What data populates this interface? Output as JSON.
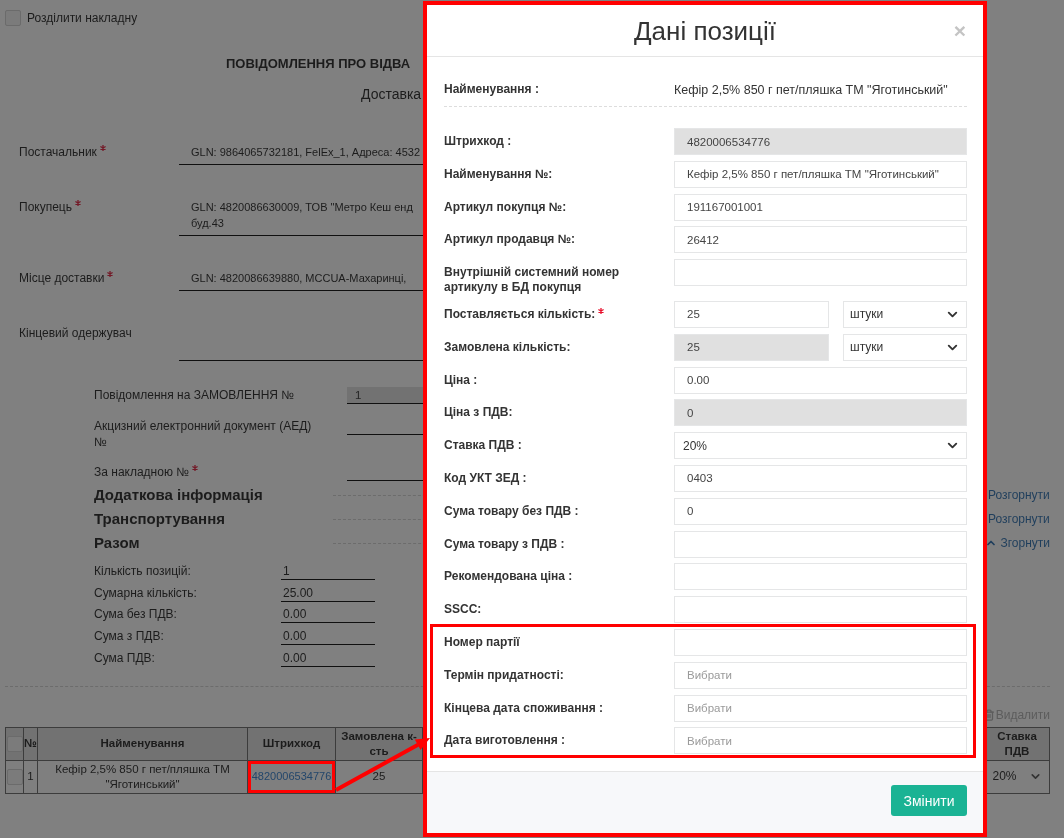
{
  "page": {
    "split_invoice": {
      "label": "Розділити накладну",
      "checked": false
    },
    "title": "ПОВІДОМЛЕННЯ ПРО ВІДВА",
    "subtitle": "Доставка",
    "parties": [
      {
        "label": "Постачальник",
        "required": true,
        "value_lines": [
          "GLN: 9864065732181, FelEx_1, Адреса: 4532"
        ]
      },
      {
        "label": "Покупець",
        "required": true,
        "value_lines": [
          "GLN: 4820086630009, ТОВ \"Метро Кеш енд",
          "буд.43"
        ]
      },
      {
        "label": "Місце доставки",
        "required": true,
        "value_lines": [
          "GLN: 4820086639880, MCCUA-Махаринці,"
        ]
      },
      {
        "label": "Кінцевий одержувач",
        "required": false
      }
    ],
    "references": [
      {
        "label": "Повідомлення на ЗАМОВЛЕННЯ №",
        "required": false,
        "readonly": true,
        "value": "1"
      },
      {
        "label": "Акцизний електронний документ (АЕД) №",
        "required": false,
        "readonly": false
      },
      {
        "label": "За накладною №",
        "required": true,
        "readonly": false
      }
    ],
    "sections": [
      {
        "title": "Додаткова інформація",
        "toggle": "Розгорнути",
        "expanded": false
      },
      {
        "title": "Транспортування",
        "toggle": "Розгорнути",
        "expanded": false
      },
      {
        "title": "Разом",
        "toggle": "Згорнути",
        "expanded": true,
        "rows": [
          {
            "label": "Кількість позицій:",
            "value": "1"
          },
          {
            "label": "Сумарна кількість:",
            "value": "25.00"
          },
          {
            "label": "Сума без ПДВ:",
            "value": "0.00"
          },
          {
            "label": "Сума з ПДВ:",
            "value": "0.00"
          },
          {
            "label": "Сума ПДВ:",
            "value": "0.00"
          }
        ]
      }
    ],
    "delete_button": {
      "label": "Видалити",
      "disabled": true
    },
    "table": {
      "select_all": {
        "checked": false
      },
      "columns": [
        "№",
        "Найменування",
        "Штрихкод",
        "Замовлена к-сть",
        "Ставка ПДВ"
      ],
      "rows": [
        {
          "checked": false,
          "number": "1",
          "name": "Кефір 2,5% 850 г пет/пляшка ТМ \"Яготинський\"",
          "barcode": "4820006534776",
          "barcode_highlighted": true,
          "ordered_qty": "25",
          "vat_rate": "20%"
        }
      ]
    }
  },
  "modal": {
    "title": "Дані позиції",
    "close": "×",
    "highlighted": true,
    "name_label": "Найменування :",
    "name_value": "Кефір 2,5% 850 г пет/пляшка ТМ \"Яготинський\"",
    "fields": [
      {
        "label": "Штрихкод :",
        "kind": "input",
        "value": "4820006534776",
        "readonly": true,
        "required": false,
        "highlighted": false
      },
      {
        "label": "Найменування №:",
        "kind": "input",
        "value": "Кефір 2,5% 850 г пет/пляшка ТМ \"Яготинський\"",
        "readonly": false,
        "required": false,
        "highlighted": false
      },
      {
        "label": "Артикул покупця №:",
        "kind": "input",
        "value": "191167001001",
        "readonly": false,
        "required": false,
        "highlighted": false
      },
      {
        "label": "Артикул продавця №:",
        "kind": "input",
        "value": "26412",
        "readonly": false,
        "required": false,
        "highlighted": false
      },
      {
        "label": "Внутрішній системний номер артикулу в БД покупця",
        "kind": "input",
        "readonly": false,
        "required": false,
        "highlighted": false
      },
      {
        "label": "Поставляється кількість:",
        "kind": "quantity",
        "value": "25",
        "unit": "штуки",
        "readonly": false,
        "required": true,
        "highlighted": false
      },
      {
        "label": "Замовлена кількість:",
        "kind": "quantity",
        "value": "25",
        "unit": "штуки",
        "readonly": true,
        "required": false,
        "highlighted": false
      },
      {
        "label": "Ціна :",
        "kind": "input",
        "value": "0.00",
        "readonly": false,
        "required": false,
        "highlighted": false
      },
      {
        "label": "Ціна з ПДВ:",
        "kind": "input",
        "value": "0",
        "readonly": true,
        "required": false,
        "highlighted": false
      },
      {
        "label": "Ставка ПДВ :",
        "kind": "select",
        "value": "20%",
        "readonly": false,
        "required": false,
        "highlighted": false
      },
      {
        "label": "Код УКТ ЗЕД :",
        "kind": "input",
        "value": "0403",
        "readonly": false,
        "required": false,
        "highlighted": false
      },
      {
        "label": "Сума товару без ПДВ :",
        "kind": "input",
        "value": "0",
        "readonly": false,
        "required": false,
        "highlighted": false
      },
      {
        "label": "Сума товару з ПДВ :",
        "kind": "input",
        "readonly": false,
        "required": false,
        "highlighted": false
      },
      {
        "label": "Рекомендована ціна :",
        "kind": "input",
        "readonly": false,
        "required": false,
        "highlighted": false
      },
      {
        "label": "SSCC:",
        "kind": "input",
        "readonly": false,
        "required": false,
        "highlighted": false
      },
      {
        "label": "Номер партії",
        "kind": "input",
        "readonly": false,
        "required": false,
        "highlighted": true
      },
      {
        "label": "Термін придатності:",
        "kind": "input",
        "placeholder": "Вибрати",
        "readonly": false,
        "required": false,
        "highlighted": true
      },
      {
        "label": "Кінцева дата споживання :",
        "kind": "input",
        "placeholder": "Вибрати",
        "readonly": false,
        "required": false,
        "highlighted": true
      },
      {
        "label": "Дата виготовлення :",
        "kind": "input",
        "placeholder": "Вибрати",
        "readonly": false,
        "required": false,
        "highlighted": true
      }
    ],
    "submit": "Змінити"
  }
}
